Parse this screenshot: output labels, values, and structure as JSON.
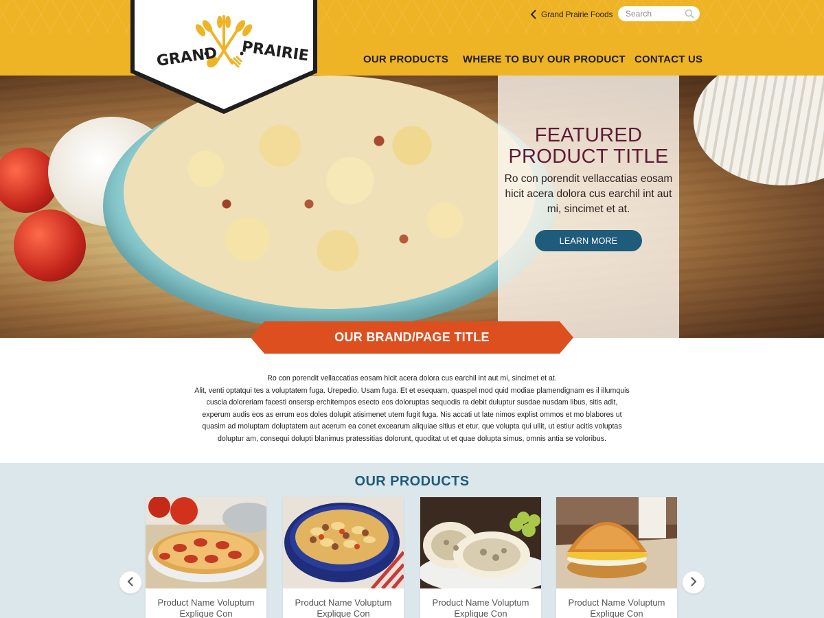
{
  "brand": {
    "logo_word_left": "GRAND",
    "logo_word_right": "PRAIRIE",
    "primary_color": "#efb425",
    "accent_color": "#dd4f1f",
    "title_color": "#5e1b35",
    "link_color": "#1f5b7b"
  },
  "header": {
    "back_link_label": "Grand Prairie Foods",
    "back_icon": "chevron-left-icon",
    "search": {
      "placeholder": "Search",
      "icon": "search-icon"
    }
  },
  "nav": {
    "items": [
      {
        "label": "OUR PRODUCTS"
      },
      {
        "label": "WHERE TO BUY OUR PRODUCT"
      },
      {
        "label": "CONTACT US"
      }
    ]
  },
  "hero": {
    "feature_title": "FEATURED PRODUCT TITLE",
    "feature_text": "Ro con porendit vellaccatias eosam hicit acera dolora cus earchil int aut mi, sincimet et at.",
    "cta_label": "LEARN MORE"
  },
  "brand_banner": {
    "title": "OUR BRAND/PAGE TITLE"
  },
  "intro": {
    "lines": [
      "Ro con porendit vellaccatias eosam hicit acera dolora cus earchil int aut mi, sincimet et at.",
      "Alit, venti optatqui tes a voluptatem fuga. Urepedio. Usam fuga. Et et esequam, quaspel mod quid modiae plamendignam es il illumquis",
      "cuscia doloreriam facesti onsersp erchitempos esecto eos doloruptas sequodis ra debit duluptur susdae nusdam libus, sitis adit,",
      "experum audis eos as errum eos doles dolupit atisimenet utem fugit fuga. Nis accati ut late nimos explist ommos et mo blabores ut",
      "quasim ad moluptam doluptatem aut acerum ea conet excearum aliquiae sitius et etur, que volupta qui ullit, ut estiur acitis voluptas",
      "doluptur am, consequi dolupti blanimus pratessitias dolorunt, quoditat ut et quae dolupta simus, omnis antia se voloribus."
    ]
  },
  "products": {
    "title": "OUR PRODUCTS",
    "prev_icon": "chevron-left-icon",
    "next_icon": "chevron-right-icon",
    "items": [
      {
        "name_line1": "Product Name Voluptum",
        "name_line2": "Explique Con",
        "image": "pizza"
      },
      {
        "name_line1": "Product Name Voluptum",
        "name_line2": "Explique Con",
        "image": "pasta-bowl"
      },
      {
        "name_line1": "Product Name Voluptum",
        "name_line2": "Explique Con",
        "image": "stuffed-bread"
      },
      {
        "name_line1": "Product Name Voluptum",
        "name_line2": "Explique Con",
        "image": "breakfast-sandwich"
      }
    ]
  }
}
